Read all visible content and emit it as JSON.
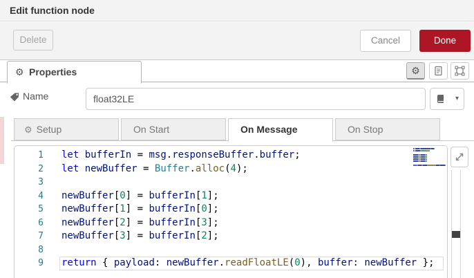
{
  "dialog": {
    "title": "Edit function node"
  },
  "toolbar": {
    "delete_label": "Delete",
    "cancel_label": "Cancel",
    "done_label": "Done"
  },
  "properties": {
    "tab_label": "Properties",
    "icon_buttons": [
      "settings",
      "description",
      "expand-frame"
    ]
  },
  "name_field": {
    "label": "Name",
    "value": "float32LE"
  },
  "func_tabs": [
    {
      "label": "Setup",
      "icon": "gear",
      "active": false
    },
    {
      "label": "On Start",
      "active": false
    },
    {
      "label": "On Message",
      "active": true
    },
    {
      "label": "On Stop",
      "active": false
    }
  ],
  "icons": {
    "gear": "⚙",
    "caret_down": "▾"
  },
  "editor": {
    "language": "javascript",
    "active_line": 9,
    "lines": [
      [
        {
          "t": "let",
          "c": "kw"
        },
        {
          "t": " ",
          "c": "pl"
        },
        {
          "t": "bufferIn",
          "c": "id"
        },
        {
          "t": " = ",
          "c": "pl"
        },
        {
          "t": "msg",
          "c": "id"
        },
        {
          "t": ".",
          "c": "pl"
        },
        {
          "t": "responseBuffer",
          "c": "id"
        },
        {
          "t": ".",
          "c": "pl"
        },
        {
          "t": "buffer",
          "c": "id"
        },
        {
          "t": ";",
          "c": "pl"
        }
      ],
      [
        {
          "t": "let",
          "c": "kw"
        },
        {
          "t": " ",
          "c": "pl"
        },
        {
          "t": "newBuffer",
          "c": "id"
        },
        {
          "t": " = ",
          "c": "pl"
        },
        {
          "t": "Buffer",
          "c": "ty"
        },
        {
          "t": ".",
          "c": "pl"
        },
        {
          "t": "alloc",
          "c": "fn"
        },
        {
          "t": "(",
          "c": "pl"
        },
        {
          "t": "4",
          "c": "nu"
        },
        {
          "t": ");",
          "c": "pl"
        }
      ],
      [],
      [
        {
          "t": "newBuffer",
          "c": "id"
        },
        {
          "t": "[",
          "c": "pl"
        },
        {
          "t": "0",
          "c": "nu"
        },
        {
          "t": "] = ",
          "c": "pl"
        },
        {
          "t": "bufferIn",
          "c": "id"
        },
        {
          "t": "[",
          "c": "pl"
        },
        {
          "t": "1",
          "c": "nu"
        },
        {
          "t": "];",
          "c": "pl"
        }
      ],
      [
        {
          "t": "newBuffer",
          "c": "id"
        },
        {
          "t": "[",
          "c": "pl"
        },
        {
          "t": "1",
          "c": "nu"
        },
        {
          "t": "] = ",
          "c": "pl"
        },
        {
          "t": "bufferIn",
          "c": "id"
        },
        {
          "t": "[",
          "c": "pl"
        },
        {
          "t": "0",
          "c": "nu"
        },
        {
          "t": "];",
          "c": "pl"
        }
      ],
      [
        {
          "t": "newBuffer",
          "c": "id"
        },
        {
          "t": "[",
          "c": "pl"
        },
        {
          "t": "2",
          "c": "nu"
        },
        {
          "t": "] = ",
          "c": "pl"
        },
        {
          "t": "bufferIn",
          "c": "id"
        },
        {
          "t": "[",
          "c": "pl"
        },
        {
          "t": "3",
          "c": "nu"
        },
        {
          "t": "];",
          "c": "pl"
        }
      ],
      [
        {
          "t": "newBuffer",
          "c": "id"
        },
        {
          "t": "[",
          "c": "pl"
        },
        {
          "t": "3",
          "c": "nu"
        },
        {
          "t": "] = ",
          "c": "pl"
        },
        {
          "t": "bufferIn",
          "c": "id"
        },
        {
          "t": "[",
          "c": "pl"
        },
        {
          "t": "2",
          "c": "nu"
        },
        {
          "t": "];",
          "c": "pl"
        }
      ],
      [],
      [
        {
          "t": "return",
          "c": "kw"
        },
        {
          "t": " { ",
          "c": "pl"
        },
        {
          "t": "payload",
          "c": "id"
        },
        {
          "t": ": ",
          "c": "pl"
        },
        {
          "t": "newBuffer",
          "c": "id"
        },
        {
          "t": ".",
          "c": "pl"
        },
        {
          "t": "readFloatLE",
          "c": "fn"
        },
        {
          "t": "(",
          "c": "pl"
        },
        {
          "t": "0",
          "c": "nu"
        },
        {
          "t": "), ",
          "c": "pl"
        },
        {
          "t": "buffer",
          "c": "id"
        },
        {
          "t": ": ",
          "c": "pl"
        },
        {
          "t": "newBuffer",
          "c": "id"
        },
        {
          "t": " };",
          "c": "pl"
        }
      ]
    ]
  },
  "colors": {
    "accent_red": "#ad1625",
    "line_number": "#237893",
    "keyword": "#0000ff",
    "identifier": "#001080",
    "type": "#267f99",
    "method": "#795e26",
    "number": "#098658",
    "chrome_bg": "#f3f3f3"
  }
}
